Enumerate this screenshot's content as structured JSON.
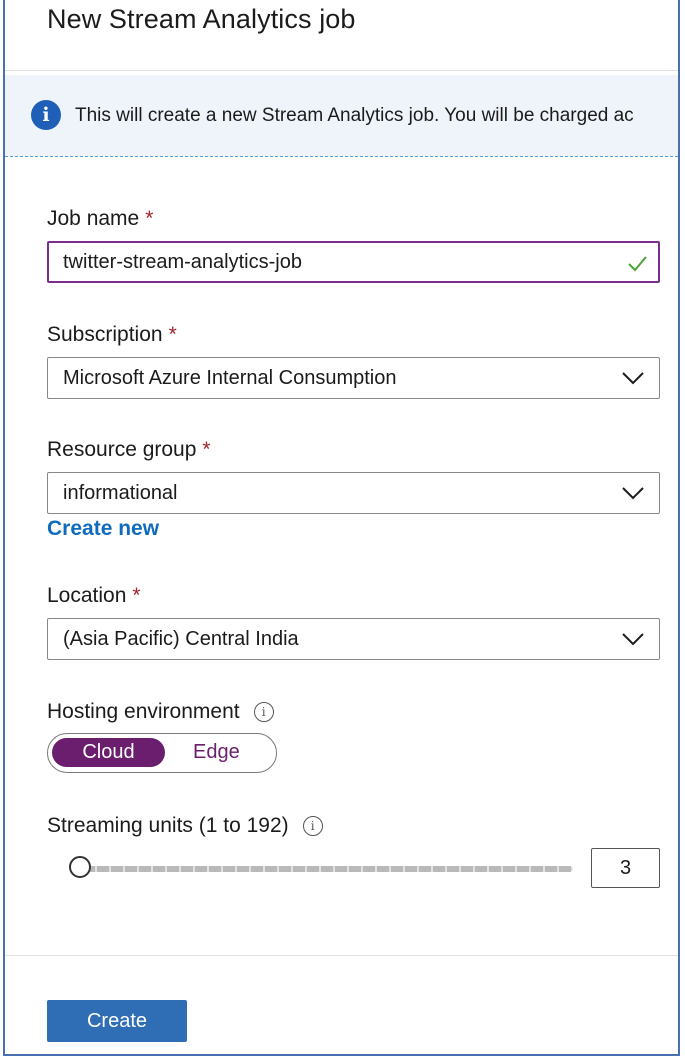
{
  "page": {
    "title": "New Stream Analytics job"
  },
  "info_banner": {
    "text": "This will create a new Stream Analytics job. You will be charged ac"
  },
  "form": {
    "job_name": {
      "label": "Job name",
      "required": "*",
      "value": "twitter-stream-analytics-job"
    },
    "subscription": {
      "label": "Subscription",
      "required": "*",
      "value": "Microsoft Azure Internal Consumption"
    },
    "resource_group": {
      "label": "Resource group",
      "required": "*",
      "value": "informational",
      "create_new": "Create new"
    },
    "location": {
      "label": "Location",
      "required": "*",
      "value": "(Asia Pacific) Central India"
    },
    "hosting": {
      "label": "Hosting environment",
      "options": [
        "Cloud",
        "Edge"
      ],
      "selected": "Cloud"
    },
    "streaming_units": {
      "label": "Streaming units (1 to 192)",
      "value": "3",
      "min": 1,
      "max": 192,
      "slider_fraction": 0.0
    }
  },
  "actions": {
    "create_label": "Create"
  },
  "icons": {
    "info": "info-icon",
    "checkmark": "checkmark-icon",
    "chevron": "chevron-down-icon"
  },
  "colors": {
    "accent": "#6b1e6e",
    "primary_button": "#2f6db5",
    "link": "#0f6cbd",
    "required": "#a4262c",
    "valid": "#4ca33a"
  }
}
